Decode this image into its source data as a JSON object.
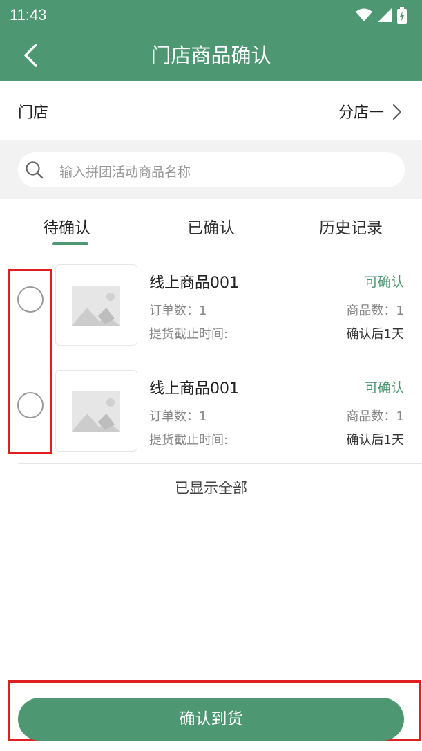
{
  "status_bar": {
    "time": "11:43",
    "icons": [
      "wifi-icon",
      "signal-icon",
      "battery-icon"
    ]
  },
  "nav": {
    "title": "门店商品确认",
    "back_icon": "chevron-left-icon"
  },
  "store": {
    "label": "门店",
    "value": "分店一"
  },
  "search": {
    "placeholder": "输入拼团活动商品名称"
  },
  "tabs": [
    {
      "label": "待确认",
      "active": true
    },
    {
      "label": "已确认",
      "active": false
    },
    {
      "label": "历史记录",
      "active": false
    }
  ],
  "items": [
    {
      "name": "线上商品001",
      "status": "可确认",
      "order_count_label": "订单数：1",
      "goods_count_label": "商品数：1",
      "deadline_label": "提货截止时间:",
      "deadline_value": "确认后1天"
    },
    {
      "name": "线上商品001",
      "status": "可确认",
      "order_count_label": "订单数：1",
      "goods_count_label": "商品数：1",
      "deadline_label": "提货截止时间:",
      "deadline_value": "确认后1天"
    }
  ],
  "list_footer": "已显示全部",
  "confirm_button": "确认到货",
  "colors": {
    "primary": "#4e9773",
    "highlight": "#e02020"
  }
}
